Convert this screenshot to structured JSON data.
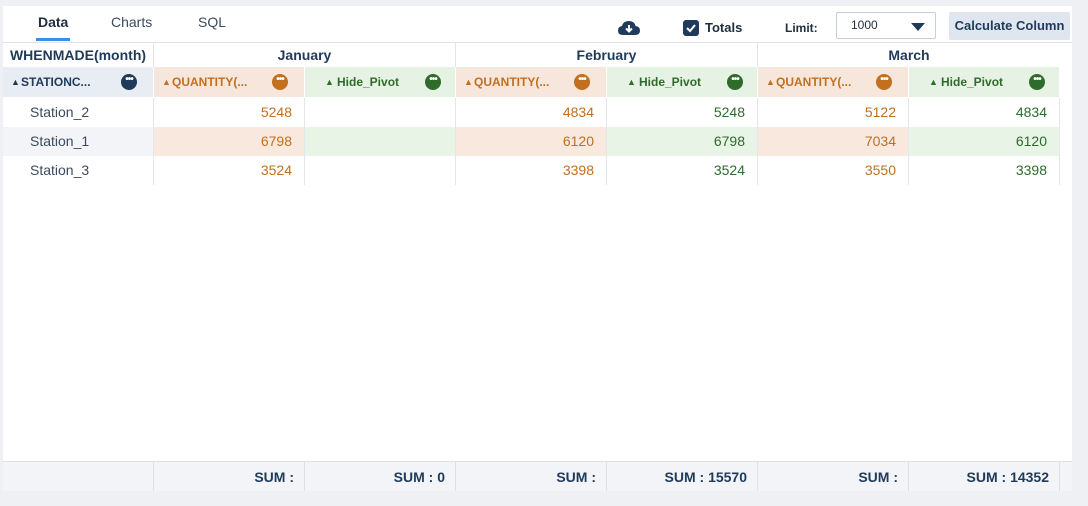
{
  "tabs": [
    {
      "label": "Data",
      "active": true
    },
    {
      "label": "Charts",
      "active": false
    },
    {
      "label": "SQL",
      "active": false
    }
  ],
  "toolbar": {
    "download_icon": "cloud-download-icon",
    "totals_label": "Totals",
    "totals_checked": true,
    "limit_label": "Limit:",
    "limit_value": "1000",
    "calc_button": "Calculate Column"
  },
  "colors": {
    "accent": "#3a8ee6",
    "navy": "#1f3a5a",
    "quantity": "#c0701f",
    "hide_pivot": "#2f6b2b"
  },
  "grid": {
    "row_dim_label": "WHENMADE(month)",
    "months": [
      "January",
      "February",
      "March"
    ],
    "station_header": "STATIONC...",
    "quantity_header": "QUANTITY(...",
    "hide_header": "Hide_Pivot",
    "rows": [
      {
        "station": "Station_2",
        "values": [
          "5248",
          "",
          "4834",
          "5248",
          "5122",
          "4834"
        ]
      },
      {
        "station": "Station_1",
        "values": [
          "6798",
          "",
          "6120",
          "6798",
          "7034",
          "6120"
        ]
      },
      {
        "station": "Station_3",
        "values": [
          "3524",
          "",
          "3398",
          "3524",
          "3550",
          "3398"
        ]
      }
    ],
    "footer": [
      "SUM :",
      "SUM : 0",
      "SUM :",
      "SUM : 15570",
      "SUM :",
      "SUM : 14352"
    ]
  }
}
